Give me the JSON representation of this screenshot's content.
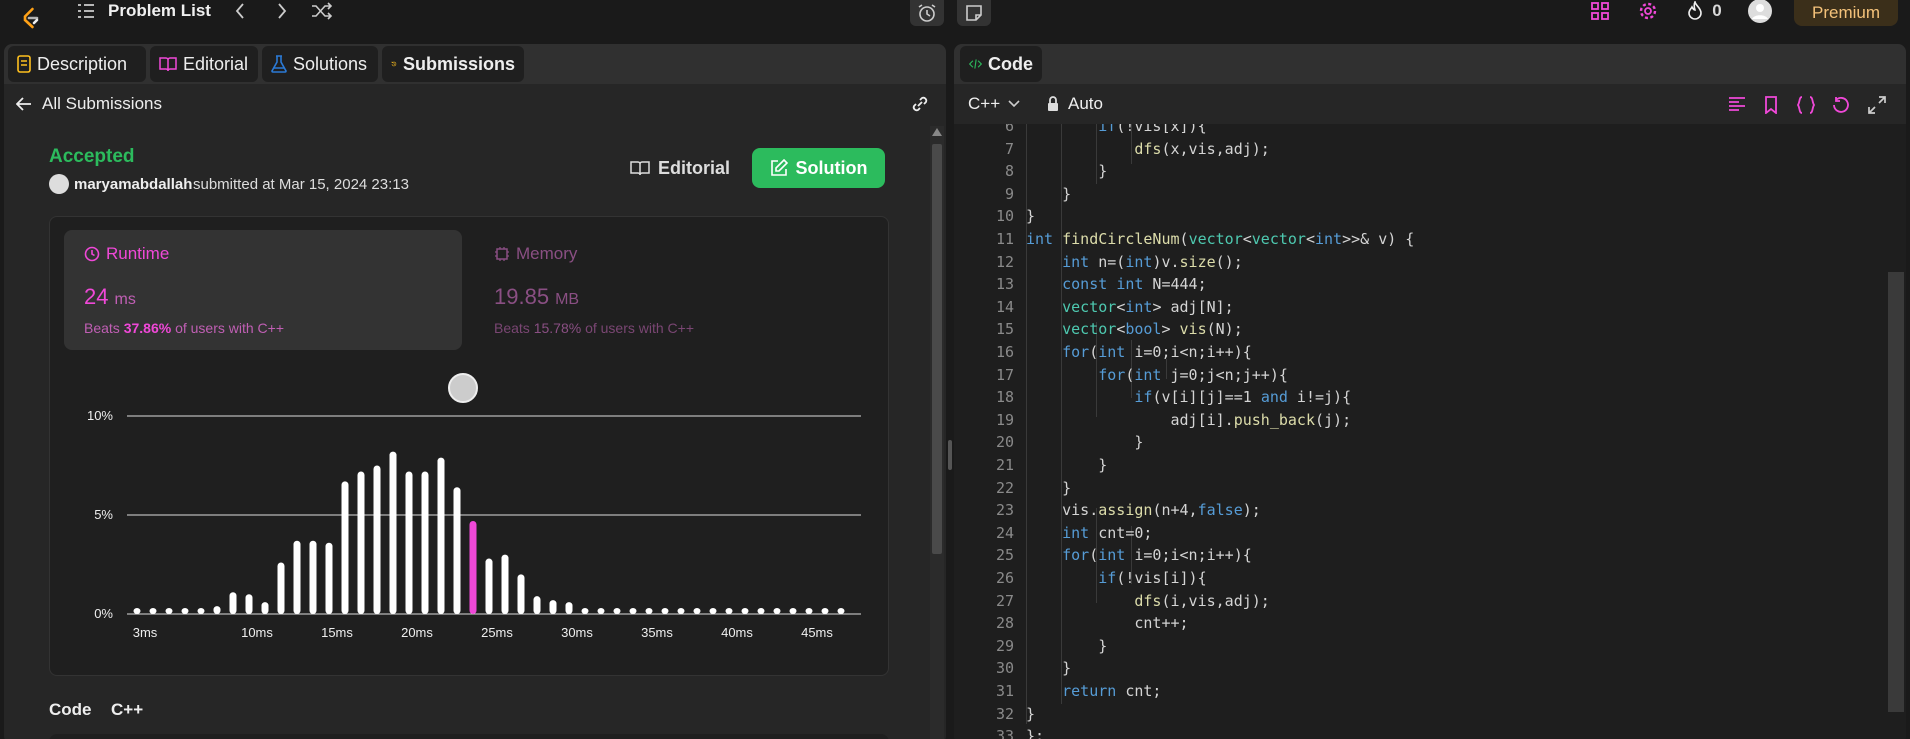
{
  "topbar": {
    "title": "Problem List",
    "streak_count": "0",
    "premium_label": "Premium"
  },
  "left_tabs": [
    {
      "label": "Description"
    },
    {
      "label": "Editorial"
    },
    {
      "label": "Solutions"
    },
    {
      "label": "Submissions"
    }
  ],
  "submission": {
    "back_label": "All Submissions",
    "status": "Accepted",
    "user": "maryamabdallah",
    "submitted_text": "submitted at Mar 15, 2024 23:13",
    "editorial_btn": "Editorial",
    "solution_btn": "Solution",
    "runtime": {
      "label": "Runtime",
      "value": "24",
      "unit": "ms",
      "beats_prefix": "Beats",
      "beats_pct": "37.86%",
      "beats_suffix": "of users with C++"
    },
    "memory": {
      "label": "Memory",
      "value": "19.85",
      "unit": "MB",
      "beats_prefix": "Beats",
      "beats_pct": "15.78%",
      "beats_suffix": "of users with C++"
    },
    "code_label": "Code",
    "lang_label": "C++"
  },
  "chart_data": {
    "type": "bar",
    "title": "",
    "xlabel": "",
    "ylabel": "",
    "ylim": [
      0,
      10
    ],
    "y_ticks": [
      "0%",
      "5%",
      "10%"
    ],
    "x_ticks": [
      "3ms",
      "10ms",
      "15ms",
      "20ms",
      "25ms",
      "30ms",
      "35ms",
      "40ms",
      "45ms"
    ],
    "highlight_index": 21,
    "values": [
      0.3,
      0.3,
      0.3,
      0.3,
      0.3,
      0.4,
      1.1,
      1.0,
      0.6,
      2.6,
      3.7,
      3.7,
      3.6,
      6.7,
      7.2,
      7.5,
      8.2,
      7.2,
      7.2,
      7.9,
      6.4,
      4.7,
      2.8,
      3.0,
      2.0,
      0.9,
      0.7,
      0.6,
      0.3,
      0.3,
      0.3,
      0.3,
      0.3,
      0.3,
      0.3,
      0.3,
      0.3,
      0.3,
      0.3,
      0.3,
      0.3,
      0.3,
      0.3,
      0.3,
      0.3
    ]
  },
  "right_tabs": [
    {
      "label": "Code"
    }
  ],
  "editor": {
    "language": "C++",
    "mode": "Auto",
    "lines": [
      {
        "n": "6",
        "text": "        if(!vis[x]){"
      },
      {
        "n": "7",
        "text": "            dfs(x,vis,adj);"
      },
      {
        "n": "8",
        "text": "        }"
      },
      {
        "n": "9",
        "text": "    }"
      },
      {
        "n": "10",
        "text": "}"
      },
      {
        "n": "11",
        "text": "int findCircleNum(vector<vector<int>>& v) {"
      },
      {
        "n": "12",
        "text": "    int n=(int)v.size();"
      },
      {
        "n": "13",
        "text": "    const int N=444;"
      },
      {
        "n": "14",
        "text": "    vector<int> adj[N];"
      },
      {
        "n": "15",
        "text": "    vector<bool> vis(N);"
      },
      {
        "n": "16",
        "text": "    for(int i=0;i<n;i++){"
      },
      {
        "n": "17",
        "text": "        for(int j=0;j<n;j++){"
      },
      {
        "n": "18",
        "text": "            if(v[i][j]==1 and i!=j){"
      },
      {
        "n": "19",
        "text": "                adj[i].push_back(j);"
      },
      {
        "n": "20",
        "text": "            }"
      },
      {
        "n": "21",
        "text": "        }"
      },
      {
        "n": "22",
        "text": "    }"
      },
      {
        "n": "23",
        "text": "    vis.assign(n+4,false);"
      },
      {
        "n": "24",
        "text": "    int cnt=0;"
      },
      {
        "n": "25",
        "text": "    for(int i=0;i<n;i++){"
      },
      {
        "n": "26",
        "text": "        if(!vis[i]){"
      },
      {
        "n": "27",
        "text": "            dfs(i,vis,adj);"
      },
      {
        "n": "28",
        "text": "            cnt++;"
      },
      {
        "n": "29",
        "text": "        }"
      },
      {
        "n": "30",
        "text": "    }"
      },
      {
        "n": "31",
        "text": "    return cnt;"
      },
      {
        "n": "32",
        "text": "}"
      },
      {
        "n": "33",
        "text": "};"
      }
    ]
  },
  "colors": {
    "accent": "#f048d8",
    "green": "#2cbb5d",
    "premium": "#f4c27a",
    "bg": "#1a1a1a",
    "panel": "#262626"
  }
}
